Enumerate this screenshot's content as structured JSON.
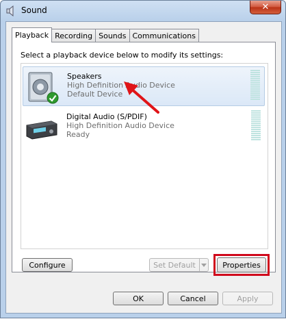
{
  "window": {
    "title": "Sound",
    "close_symbol": "✕"
  },
  "tabs": [
    {
      "label": "Playback",
      "active": true
    },
    {
      "label": "Recording",
      "active": false
    },
    {
      "label": "Sounds",
      "active": false
    },
    {
      "label": "Communications",
      "active": false
    }
  ],
  "instruction": "Select a playback device below to modify its settings:",
  "devices": [
    {
      "name": "Speakers",
      "description": "High Definition Audio Device",
      "status": "Default Device",
      "icon": "speaker-icon",
      "default_badge": "check-badge-icon",
      "selected": true
    },
    {
      "name": "Digital Audio (S/PDIF)",
      "description": "High Definition Audio Device",
      "status": "Ready",
      "icon": "digital-receiver-icon",
      "selected": false
    }
  ],
  "buttons": {
    "configure": "Configure",
    "set_default": "Set Default",
    "properties": "Properties",
    "ok": "OK",
    "cancel": "Cancel",
    "apply": "Apply"
  },
  "colors": {
    "highlight": "#d0081c",
    "selection": "#dbe8f7",
    "meter": "#bfe3e0"
  }
}
